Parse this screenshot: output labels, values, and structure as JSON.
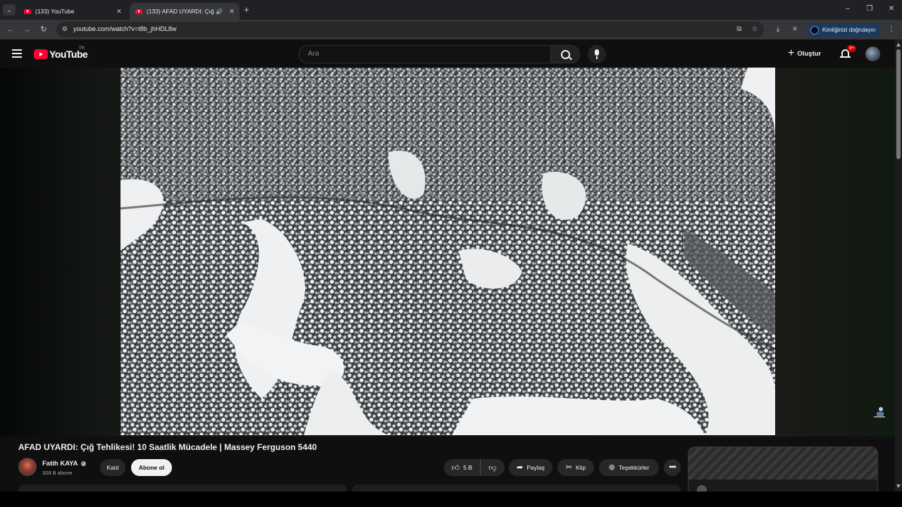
{
  "browser": {
    "tabs": [
      {
        "title": "(133) YouTube",
        "active": false
      },
      {
        "title": "(133) AFAD UYARDI: Çığ Tehlikesi!",
        "active": true
      }
    ],
    "new_tab": "+",
    "url": "youtube.com/watch?v=t8b_jhHDL8w",
    "profile_button": "Kimliğinizi doğrulayın",
    "window_controls": {
      "minimize": "–",
      "restore": "❐",
      "close": "✕"
    }
  },
  "youtube": {
    "logo": "YouTube",
    "country_code": "TR",
    "search_placeholder": "Ara",
    "create_label": "Oluştur",
    "notifications_badge": "9+"
  },
  "video": {
    "title": "AFAD UYARDI: Çığ Tehlikesi! 10 Saatlik Mücadele | Massey Ferguson 5440",
    "channel_name": "Fatih KAYA",
    "subscribers": "308 B abone",
    "join_label": "Katıl",
    "subscribe_label": "Abone ol",
    "like_count": "5 B",
    "share_label": "Paylaş",
    "clip_label": "Klip",
    "thanks_label": "Teşekkürler"
  },
  "colors": {
    "brand_red": "#ff0033",
    "page_bg": "#0f0f0f",
    "pill_bg": "#272727",
    "profile_pill": "#1b3a5c"
  },
  "icons": {
    "search": "search-icon",
    "mic": "mic-icon",
    "bell": "bell-icon",
    "like": "thumbs-up-icon",
    "dislike": "thumbs-down-icon",
    "share": "share-arrow-icon",
    "clip": "scissors-icon",
    "thanks": "thanks-dollar-icon",
    "more": "more-horizontal-icon"
  }
}
